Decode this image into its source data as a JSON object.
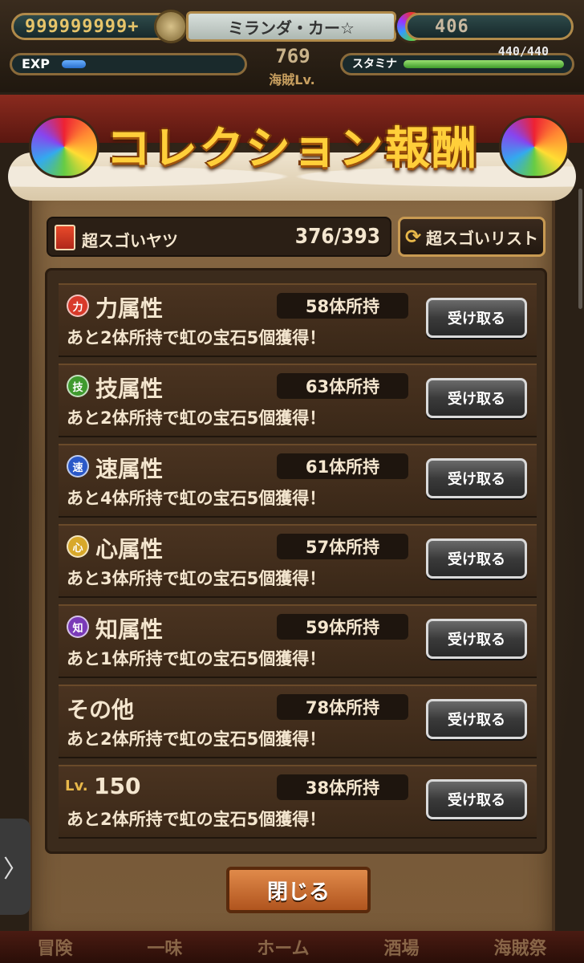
{
  "hud": {
    "berry": "999999999+",
    "player_name": "ミランダ・カー☆",
    "gems": "406",
    "exp_label": "EXP",
    "exp_fraction": 0.1,
    "level": "769",
    "level_label": "海賊Lv.",
    "stamina_label": "スタミナ",
    "stamina_value": "440/440",
    "stamina_fraction": 1.0
  },
  "modal": {
    "title": "コレクション報酬",
    "header": {
      "label": "超スゴいヤツ",
      "count": "376/393",
      "list_button": "超スゴいリスト"
    },
    "rows": [
      {
        "badge": "力",
        "badge_color": "#d83a2a",
        "title": "力属性",
        "count": "58体所持",
        "desc": "あと2体所持で虹の宝石5個獲得！",
        "button": "受け取る"
      },
      {
        "badge": "技",
        "badge_color": "#3f9a2e",
        "title": "技属性",
        "count": "63体所持",
        "desc": "あと2体所持で虹の宝石5個獲得！",
        "button": "受け取る"
      },
      {
        "badge": "速",
        "badge_color": "#2a58c8",
        "title": "速属性",
        "count": "61体所持",
        "desc": "あと4体所持で虹の宝石5個獲得！",
        "button": "受け取る"
      },
      {
        "badge": "心",
        "badge_color": "#d8a82a",
        "title": "心属性",
        "count": "57体所持",
        "desc": "あと3体所持で虹の宝石5個獲得！",
        "button": "受け取る"
      },
      {
        "badge": "知",
        "badge_color": "#7a3ab8",
        "title": "知属性",
        "count": "59体所持",
        "desc": "あと1体所持で虹の宝石5個獲得！",
        "button": "受け取る"
      },
      {
        "badge": "",
        "badge_color": "",
        "title": "その他",
        "count": "78体所持",
        "desc": "あと2体所持で虹の宝石5個獲得！",
        "button": "受け取る"
      },
      {
        "badge": "Lv.",
        "badge_color": "#e8b84a",
        "title": "150",
        "count": "38体所持",
        "desc": "あと2体所持で虹の宝石5個獲得！",
        "button": "受け取る"
      }
    ],
    "close_button": "閉じる"
  },
  "nav": {
    "items": [
      "冒険",
      "一味",
      "ホーム",
      "酒場",
      "海賊祭"
    ]
  },
  "side_tab_glyph": "〉"
}
